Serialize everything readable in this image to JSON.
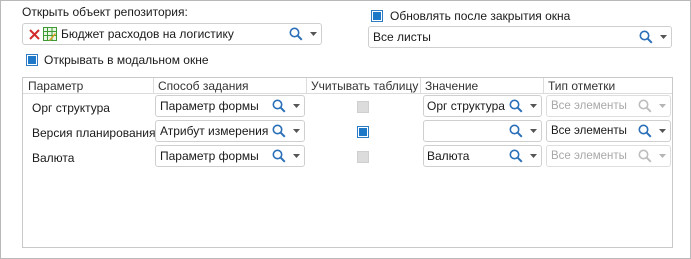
{
  "open_object": {
    "label": "Открыть объект репозитория:",
    "value": "Бюджет расходов на логистику",
    "clear_icon": "red-x-icon",
    "object_icon": "spreadsheet-icon"
  },
  "refresh_after_close": {
    "label": "Обновлять после закрытия окна",
    "checked": true,
    "sheets_value": "Все листы"
  },
  "modal_window": {
    "label": "Открывать в модальном окне",
    "checked": true
  },
  "grid": {
    "columns": [
      "Параметр",
      "Способ задания",
      "Учитывать таблицу",
      "Значение",
      "Тип отметки"
    ],
    "rows": [
      {
        "param": "Орг структура",
        "method": "Параметр формы",
        "use_table": false,
        "use_table_enabled": false,
        "value": "Орг структура",
        "mark_type": "Все элементы",
        "mark_type_enabled": false
      },
      {
        "param": "Версия планирования",
        "method": "Атрибут измерения",
        "use_table": true,
        "use_table_enabled": true,
        "value": "",
        "mark_type": "Все элементы",
        "mark_type_enabled": true
      },
      {
        "param": "Валюта",
        "method": "Параметр формы",
        "use_table": false,
        "use_table_enabled": false,
        "value": "Валюта",
        "mark_type": "Все элементы",
        "mark_type_enabled": false
      }
    ]
  },
  "icons": {
    "search": "magnifier-icon",
    "dropdown": "chevron-down-icon"
  },
  "colors": {
    "accent": "#1e78c8",
    "clear_red": "#d22b2b",
    "disabled_text": "#a8a8a8"
  }
}
